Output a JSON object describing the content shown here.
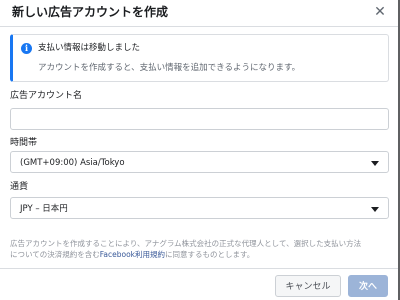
{
  "dialog": {
    "title": "新しい広告アカウントを作成",
    "close_icon": "close-icon"
  },
  "notice": {
    "icon": "info-icon",
    "title": "支払い情報は移動しました",
    "body": "アカウントを作成すると、支払い情報を追加できるようになります。",
    "accent_color": "#1877f2"
  },
  "fields": {
    "account_name": {
      "label": "広告アカウント名",
      "value": ""
    },
    "timezone": {
      "label": "時間帯",
      "value": "(GMT+09:00) Asia/Tokyo"
    },
    "currency": {
      "label": "通貨",
      "value": "JPY – 日本円"
    }
  },
  "terms": {
    "line1": "広告アカウントを作成することにより、アナグラム株式会社の正式な代理人として、選択した支払い方法",
    "line2_prefix": "についての決済規約を含む",
    "link": "Facebook利用規約",
    "line2_suffix": "に同意するものとします。"
  },
  "footer": {
    "cancel_label": "キャンセル",
    "next_label": "次へ"
  }
}
